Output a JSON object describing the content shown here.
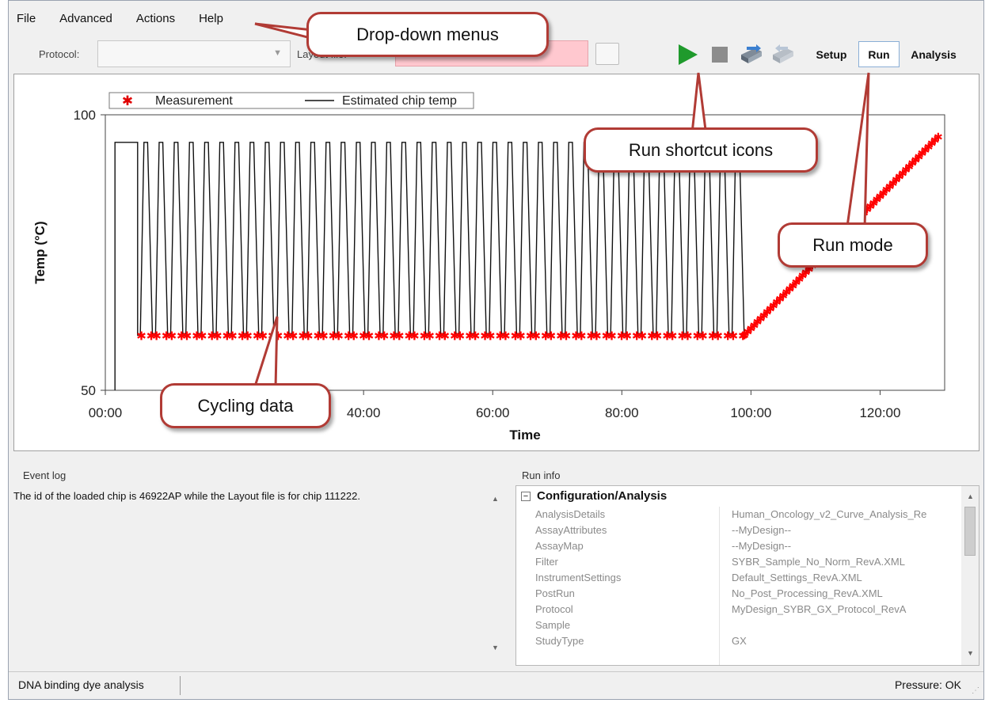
{
  "menu": {
    "items": [
      "File",
      "Advanced",
      "Actions",
      "Help"
    ]
  },
  "toolbar": {
    "protocol_label": "Protocol:",
    "layout_label": "Layout file:",
    "protocol_value": "",
    "layout_value": "",
    "modes": [
      "Setup",
      "Run",
      "Analysis"
    ],
    "active_mode": "Run",
    "icons": [
      "play-icon",
      "stop-icon",
      "load-chip-icon",
      "eject-chip-icon"
    ],
    "colors": {
      "play": "#1f9a2c",
      "stop": "#8c8c8c",
      "active_border": "#8aaed6",
      "layout_field": "#ffc8cf"
    }
  },
  "chart_data": {
    "type": "line",
    "xlabel": "Time",
    "ylabel": "Temp (°C)",
    "xlim": [
      0,
      130
    ],
    "ylim": [
      50,
      100
    ],
    "x_ticks": [
      "00:00",
      "40:00",
      "60:00",
      "80:00",
      "100:00",
      "120:00"
    ],
    "y_ticks": [
      "100",
      "50"
    ],
    "legend": [
      "Measurement",
      "Estimated chip temp"
    ],
    "legend_position": "top-left",
    "series": [
      {
        "name": "Estimated chip temp",
        "color": "#111111",
        "description_points": {
          "preheat": [
            [
              1.5,
              50
            ],
            [
              1.5,
              95
            ],
            [
              5,
              95
            ],
            [
              5,
              60
            ]
          ],
          "cycles": 40,
          "cycle_low": 60,
          "cycle_high": 95,
          "cycle_start": 5,
          "cycle_end": 99,
          "melt": [
            [
              99,
              60
            ],
            [
              129,
              96
            ]
          ]
        }
      },
      {
        "name": "Measurement",
        "color": "#ff0000",
        "marker": "asterisk",
        "low_level": 60,
        "melt_range": [
          [
            99,
            60
          ],
          [
            129,
            96
          ]
        ]
      }
    ]
  },
  "event_log": {
    "title": "Event log",
    "text": "The id of the loaded chip is 46922AP while the Layout file is for chip 111222."
  },
  "run_info": {
    "title": "Run info",
    "category": "Configuration/Analysis",
    "rows": [
      {
        "key": "AnalysisDetails",
        "value": "Human_Oncology_v2_Curve_Analysis_Re"
      },
      {
        "key": "AssayAttributes",
        "value": "--MyDesign--"
      },
      {
        "key": "AssayMap",
        "value": "--MyDesign--"
      },
      {
        "key": "Filter",
        "value": "SYBR_Sample_No_Norm_RevA.XML"
      },
      {
        "key": "InstrumentSettings",
        "value": "Default_Settings_RevA.XML"
      },
      {
        "key": "PostRun",
        "value": "No_Post_Processing_RevA.XML"
      },
      {
        "key": "Protocol",
        "value": "MyDesign_SYBR_GX_Protocol_RevA"
      },
      {
        "key": "Sample",
        "value": ""
      },
      {
        "key": "StudyType",
        "value": "GX"
      }
    ]
  },
  "status": {
    "left": "DNA binding dye analysis",
    "right": "Pressure: OK"
  },
  "callouts": {
    "menus": "Drop-down menus",
    "shortcuts": "Run shortcut icons",
    "mode": "Run mode",
    "cycling": "Cycling data",
    "border_color": "#b13b35"
  }
}
